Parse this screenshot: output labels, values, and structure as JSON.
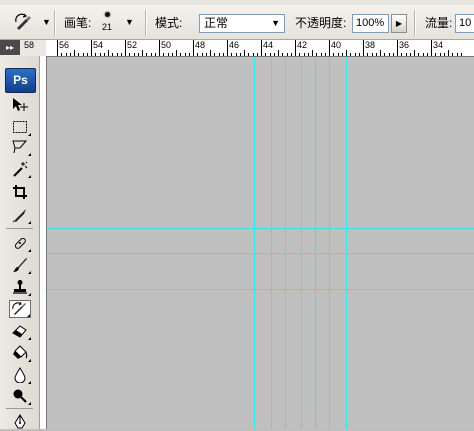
{
  "app": {
    "logo_text": "Ps",
    "toolbox_grip": "▸▸"
  },
  "options": {
    "brush_label": "画笔:",
    "brush_size": "21",
    "mode_label": "模式:",
    "mode_value": "正常",
    "opacity_label": "不透明度:",
    "opacity_value": "100%",
    "flow_label": "流量:",
    "flow_value": "10"
  },
  "ruler": {
    "corner_label": "58",
    "labels": [
      "56",
      "54",
      "52",
      "50",
      "48",
      "46",
      "44",
      "42",
      "40",
      "38",
      "36",
      "34"
    ]
  },
  "tools": [
    "move-tool",
    "marquee-tool",
    "lasso-tool",
    "magic-wand-tool",
    "crop-tool",
    "slice-tool",
    "healing-brush-tool",
    "brush-tool",
    "clone-stamp-tool",
    "history-brush-tool",
    "eraser-tool",
    "paint-bucket-tool",
    "blur-tool",
    "dodge-tool",
    "pen-tool"
  ],
  "active_tool": "history-brush-tool",
  "colors": {
    "guide": "#35e8e8",
    "canvas": "#c0c0c0"
  }
}
